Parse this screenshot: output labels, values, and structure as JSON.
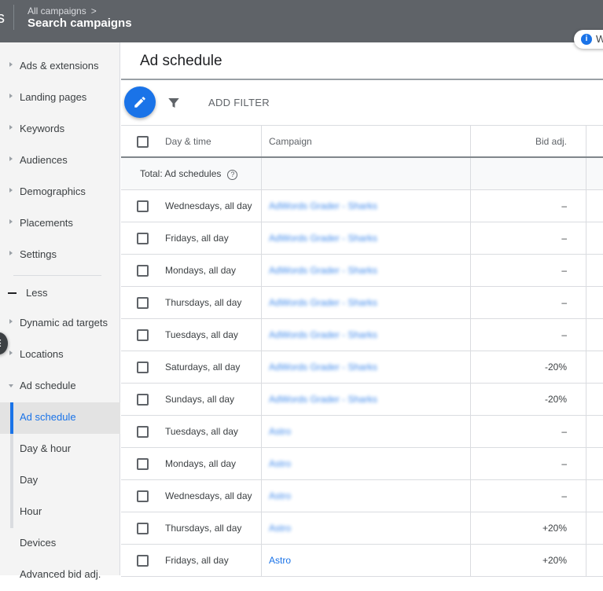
{
  "topbar": {
    "logo_fragment": "s",
    "breadcrumb": "All campaigns",
    "breadcrumb_chevron": ">",
    "campaign_title": "Search campaigns",
    "notice_icon": "i",
    "notice_text": "W"
  },
  "sidebar": {
    "items": [
      {
        "label": "Ads & extensions",
        "icon": "triangle-right"
      },
      {
        "label": "Landing pages",
        "icon": "triangle-right"
      },
      {
        "label": "Keywords",
        "icon": "triangle-right"
      },
      {
        "label": "Audiences",
        "icon": "triangle-right"
      },
      {
        "label": "Demographics",
        "icon": "triangle-right"
      },
      {
        "label": "Placements",
        "icon": "triangle-right"
      },
      {
        "label": "Settings",
        "icon": "triangle-right"
      }
    ],
    "less_label": "Less",
    "more_items": [
      {
        "label": "Dynamic ad targets",
        "icon": "triangle-right"
      },
      {
        "label": "Locations",
        "icon": "triangle-right"
      },
      {
        "label": "Ad schedule",
        "icon": "triangle-down"
      }
    ],
    "sub_items": [
      {
        "label": "Ad schedule",
        "active": true
      },
      {
        "label": "Day & hour"
      },
      {
        "label": "Day"
      },
      {
        "label": "Hour"
      }
    ],
    "after_items": [
      {
        "label": "Devices"
      },
      {
        "label": "Advanced bid adj."
      }
    ],
    "collapse_icon": "⋮"
  },
  "main": {
    "title": "Ad schedule",
    "toolbar": {
      "edit_icon": "pencil-icon",
      "filter_icon": "filter-icon",
      "add_filter_label": "ADD FILTER"
    },
    "table": {
      "columns": [
        "Day & time",
        "Campaign",
        "Bid adj."
      ],
      "total_label": "Total: Ad schedules",
      "help_icon": "?",
      "rows": [
        {
          "day": "Wednesdays, all day",
          "campaign": "AdWords Grader - Sharks",
          "bid": "–",
          "blurred": true
        },
        {
          "day": "Fridays, all day",
          "campaign": "AdWords Grader - Sharks",
          "bid": "–",
          "blurred": true
        },
        {
          "day": "Mondays, all day",
          "campaign": "AdWords Grader - Sharks",
          "bid": "–",
          "blurred": true
        },
        {
          "day": "Thursdays, all day",
          "campaign": "AdWords Grader - Sharks",
          "bid": "–",
          "blurred": true
        },
        {
          "day": "Tuesdays, all day",
          "campaign": "AdWords Grader - Sharks",
          "bid": "–",
          "blurred": true
        },
        {
          "day": "Saturdays, all day",
          "campaign": "AdWords Grader - Sharks",
          "bid": "-20%",
          "blurred": true
        },
        {
          "day": "Sundays, all day",
          "campaign": "AdWords Grader - Sharks",
          "bid": "-20%",
          "blurred": true
        },
        {
          "day": "Tuesdays, all day",
          "campaign": "Astro",
          "bid": "–",
          "blurred": true
        },
        {
          "day": "Mondays, all day",
          "campaign": "Astro",
          "bid": "–",
          "blurred": true
        },
        {
          "day": "Wednesdays, all day",
          "campaign": "Astro",
          "bid": "–",
          "blurred": true
        },
        {
          "day": "Thursdays, all day",
          "campaign": "Astro",
          "bid": "+20%",
          "blurred": true
        },
        {
          "day": "Fridays, all day",
          "campaign": "Astro",
          "bid": "+20%",
          "blurred": false
        }
      ]
    }
  },
  "colors": {
    "topbar": "#5f6368",
    "accent": "#1a73e8",
    "sidebar_bg": "#f4f4f4",
    "active_bg": "#e3e3e3"
  }
}
